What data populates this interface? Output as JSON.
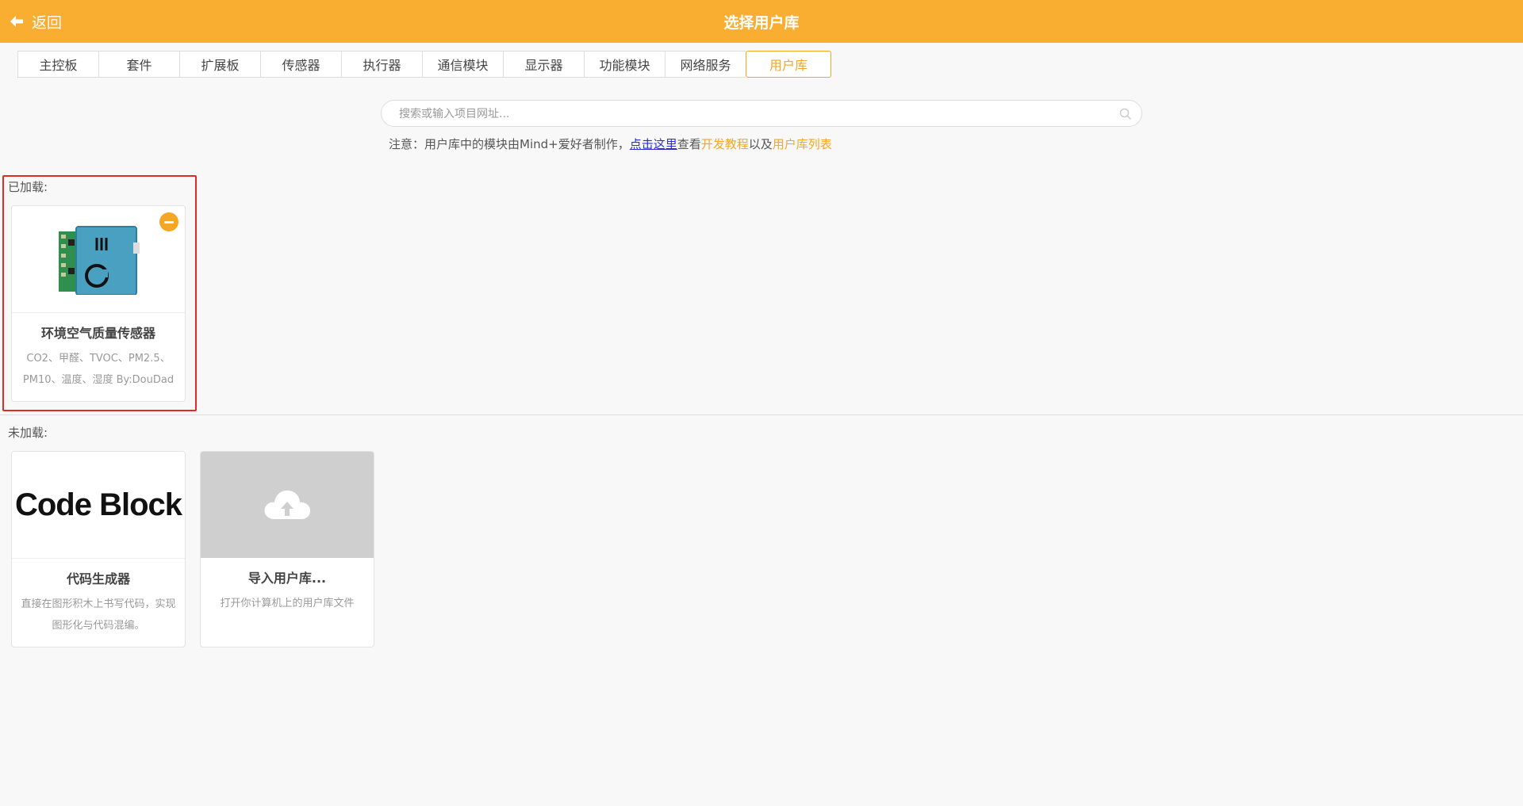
{
  "header": {
    "back_label": "返回",
    "title": "选择用户库",
    "background": "#f9ae32"
  },
  "tabs": [
    {
      "label": "主控板",
      "active": false
    },
    {
      "label": "套件",
      "active": false
    },
    {
      "label": "扩展板",
      "active": false
    },
    {
      "label": "传感器",
      "active": false
    },
    {
      "label": "执行器",
      "active": false
    },
    {
      "label": "通信模块",
      "active": false
    },
    {
      "label": "显示器",
      "active": false
    },
    {
      "label": "功能模块",
      "active": false
    },
    {
      "label": "网络服务",
      "active": false
    },
    {
      "label": "用户库",
      "active": true
    }
  ],
  "search": {
    "placeholder": "搜索或输入项目网址...",
    "value": ""
  },
  "note": {
    "prefix": "注意：用户库中的模块由Mind+爱好者制作，",
    "click_here": "点击这里",
    "view": "查看",
    "dev_tutorial": "开发教程",
    "and": "以及",
    "user_lib_list": "用户库列表"
  },
  "loaded": {
    "label": "已加载:",
    "items": [
      {
        "name": "环境空气质量传感器",
        "description": "CO2、甲醛、TVOC、PM2.5、PM10、温度、湿度 By:DouDad",
        "icon": "air-quality-sensor-board"
      }
    ]
  },
  "unloaded": {
    "label": "未加载:",
    "items": [
      {
        "name": "代码生成器",
        "description": "直接在图形积木上书写代码，实现图形化与代码混编。",
        "thumb_text": "Code Block"
      },
      {
        "name": "导入用户库...",
        "description": "打开你计算机上的用户库文件",
        "icon": "cloud-upload-icon"
      }
    ]
  },
  "colors": {
    "accent": "#f5a623",
    "highlight": "#e12b2b",
    "link": "#2b2bd6"
  }
}
